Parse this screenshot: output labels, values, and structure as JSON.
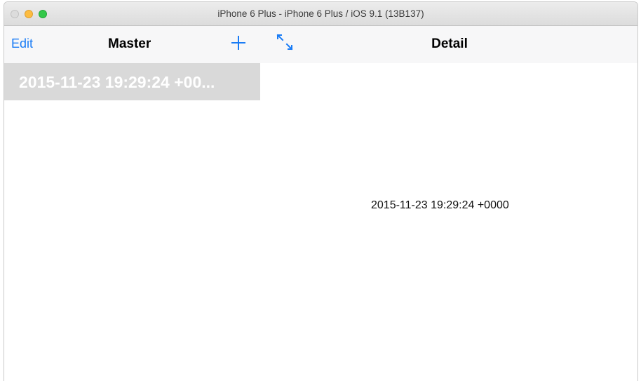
{
  "window": {
    "title": "iPhone 6 Plus - iPhone 6 Plus / iOS 9.1 (13B137)"
  },
  "master": {
    "nav": {
      "edit_label": "Edit",
      "title": "Master",
      "add_icon": "plus-icon"
    },
    "rows": [
      {
        "label": "2015-11-23 19:29:24 +00..."
      }
    ]
  },
  "detail": {
    "nav": {
      "expand_icon": "expand-arrows-icon",
      "title": "Detail"
    },
    "label": "2015-11-23 19:29:24 +0000"
  },
  "colors": {
    "accent": "#1a7cf5",
    "nav_background": "#f7f7f8",
    "selected_row": "#d9d9d9"
  }
}
